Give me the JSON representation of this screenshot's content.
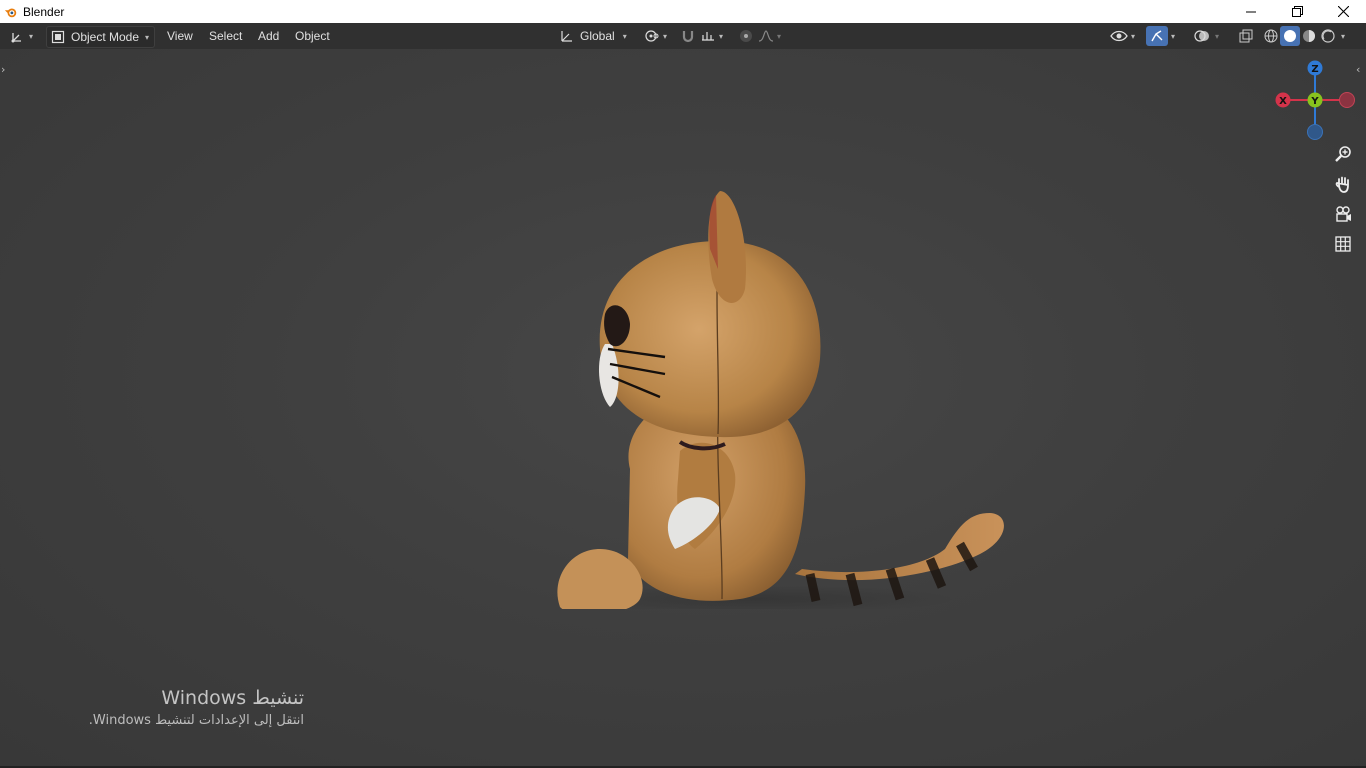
{
  "window": {
    "title": "Blender"
  },
  "header": {
    "mode_label": "Object Mode",
    "menu": [
      "View",
      "Select",
      "Add",
      "Object"
    ],
    "transform_orientation": "Global"
  },
  "gizmo": {
    "z": "Z",
    "y": "Y",
    "x": "X"
  },
  "watermark": {
    "line1": "تنشيط Windows",
    "line2": "انتقل إلى الإعدادات لتنشيط Windows."
  },
  "colors": {
    "axis_x": "#d4334a",
    "axis_y": "#88c21e",
    "axis_z": "#2f7ad6",
    "active_blue": "#4772b3"
  }
}
